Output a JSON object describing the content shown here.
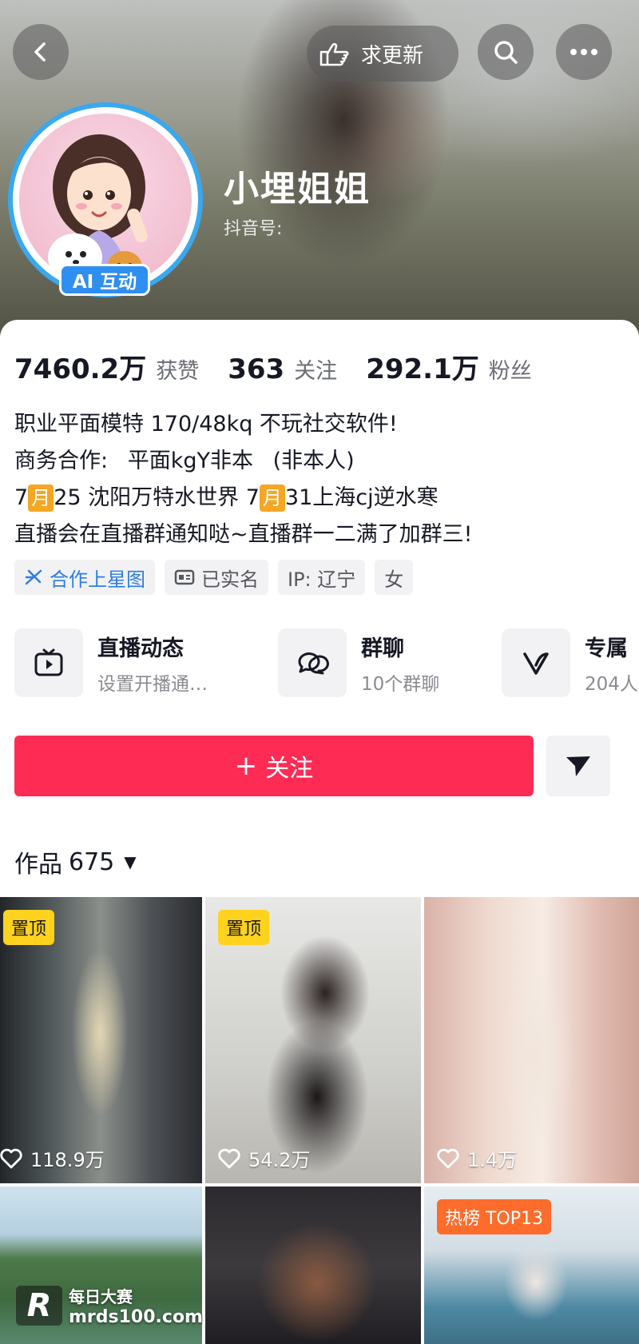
{
  "header": {
    "request_update_label": "求更新",
    "back_icon": "chevron-left-icon",
    "search_icon": "search-icon",
    "more_icon": "more-horizontal-icon",
    "hand_icon": "pointing-hand-icon"
  },
  "profile": {
    "name": "小埋姐姐",
    "douyin_id_label": "抖音号:",
    "ai_badge": "AI 互动"
  },
  "stats": [
    {
      "value": "7460.2万",
      "label": "获赞"
    },
    {
      "value": "363",
      "label": "关注"
    },
    {
      "value": "292.1万",
      "label": "粉丝"
    }
  ],
  "bio": {
    "line1": "职业平面模特 170/48kq 不玩社交软件!",
    "line2": "商务合作:",
    "line2_b": "平面",
    "line2_c": "kgY非本",
    "line2_d": "(非本人)",
    "line3_a": "7",
    "line3_month1": "月",
    "line3_b": "25 沈阳万特水世界 7",
    "line3_month2": "月",
    "line3_c": "31上海cj逆水寒",
    "line4": "直播会在直播群通知哒~直播群一二满了加群三!"
  },
  "tags": [
    {
      "label": "合作上星图",
      "icon": "star-map-icon"
    },
    {
      "label": "已实名",
      "icon": "id-card-icon"
    },
    {
      "label": "IP: 辽宁"
    },
    {
      "label": "女"
    }
  ],
  "features": [
    {
      "title": "直播动态",
      "sub": "设置开播通…",
      "icon": "tv-icon"
    },
    {
      "title": "群聊",
      "sub": "10个群聊",
      "icon": "chat-bubbles-icon"
    },
    {
      "title": "专属",
      "sub": "204人",
      "icon": "v-icon"
    }
  ],
  "actions": {
    "follow_label": "关注",
    "follow_plus": "+",
    "share_icon": "send-icon"
  },
  "works": {
    "label": "作品",
    "count": "675",
    "caret": "▼"
  },
  "grid": [
    {
      "badge": "置顶",
      "likes": "118.9万"
    },
    {
      "badge": "置顶",
      "likes": "54.2万"
    },
    {
      "badge": "",
      "likes": "1.4万"
    },
    {
      "badge": "",
      "likes": ""
    },
    {
      "badge": "",
      "likes": ""
    },
    {
      "badge": "热榜 TOP13",
      "likes": ""
    }
  ],
  "watermark": {
    "logo": "R",
    "name": "每日大赛",
    "url": "mrds100.com"
  },
  "colors": {
    "follow_button": "#fe2c55",
    "avatar_ring": "#3aa8ee",
    "ai_badge": "#2f8ff0",
    "pin_badge": "#ffd21e",
    "rank_badge": "#fe6c2c",
    "month_box": "#f6a623"
  }
}
